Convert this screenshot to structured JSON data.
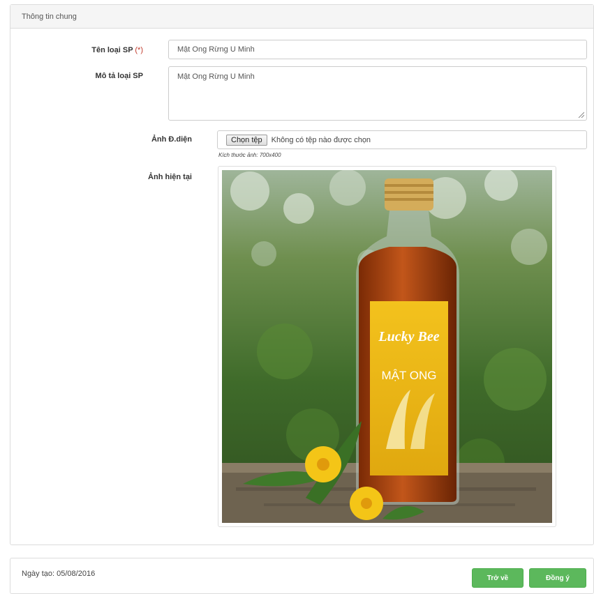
{
  "panel": {
    "heading": "Thông tin chung"
  },
  "form": {
    "name_label": "Tên loại SP",
    "required_mark": "(*)",
    "name_value": "Mật Ong Rừng U Minh",
    "desc_label": "Mô tả loại SP",
    "desc_value": "Mật Ong Rừng U Minh",
    "image_label": "Ảnh Đ.diện",
    "file_button": "Chọn tệp",
    "file_status": "Không có tệp nào được chọn",
    "size_hint": "Kích thước ảnh: 700x400",
    "current_image_label": "Ảnh hiện tại"
  },
  "product_image": {
    "brand": "Lucky Bee",
    "title": "MẬT ONG"
  },
  "footer": {
    "created": "Ngày tạo: 05/08/2016",
    "back_label": "Trở về",
    "submit_label": "Đồng ý"
  },
  "colors": {
    "primary_button": "#5cb85c",
    "required": "#c0392b"
  }
}
